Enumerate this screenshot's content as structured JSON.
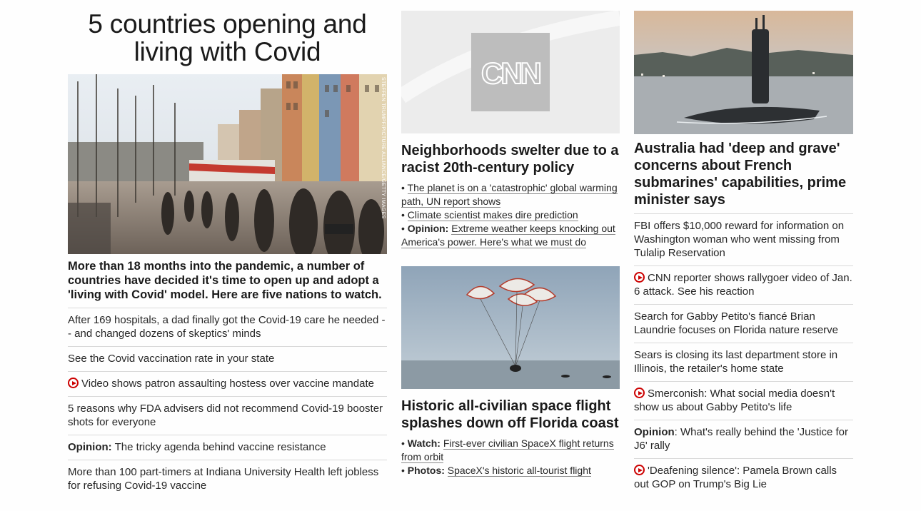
{
  "lead": {
    "title": "5 countries opening and living with Covid",
    "image_credit": "STEFFEN TRUMPF/PICTURE ALLIANCE/GETTY IMAGES",
    "summary": "More than 18 months into the pandemic, a number of countries have decided it's time to open up and adopt a 'living with Covid' model. Here are five nations to watch.",
    "links": [
      {
        "prefix": "",
        "text": "After 169 hospitals, a dad finally got the Covid-19 care he needed -- and changed dozens of skeptics' minds",
        "video": false
      },
      {
        "prefix": "",
        "text": "See the Covid vaccination rate in your state",
        "video": false
      },
      {
        "prefix": "",
        "text": "Video shows patron assaulting hostess over vaccine mandate",
        "video": true
      },
      {
        "prefix": "",
        "text": "5 reasons why FDA advisers did not recommend Covid-19 booster shots for everyone",
        "video": false
      },
      {
        "prefix": "Opinion:",
        "text": "The tricky agenda behind vaccine resistance",
        "video": false
      },
      {
        "prefix": "",
        "text": "More than 100 part-timers at Indiana University Health left jobless for refusing Covid-19 vaccine",
        "video": false
      }
    ]
  },
  "middle": {
    "story1": {
      "logo_text": "CNN",
      "headline": "Neighborhoods swelter due to a racist 20th-century policy",
      "bullets": [
        {
          "prefix": "",
          "text": "The planet is on a 'catastrophic' global warming path, UN report shows"
        },
        {
          "prefix": "",
          "text": "Climate scientist makes dire prediction"
        },
        {
          "prefix": "Opinion:",
          "text": "Extreme weather keeps knocking out America's power. Here's what we must do"
        }
      ]
    },
    "story2": {
      "headline": "Historic all-civilian space flight splashes down off Florida coast",
      "bullets": [
        {
          "prefix": "Watch:",
          "text": "First-ever civilian SpaceX flight returns from orbit"
        },
        {
          "prefix": "Photos:",
          "text": "SpaceX's historic all-tourist flight"
        }
      ]
    }
  },
  "right": {
    "headline": "Australia had 'deep and grave' concerns about French submarines' capabilities, prime minister says",
    "links": [
      {
        "prefix": "",
        "text": "FBI offers $10,000 reward for information on Washington woman who went missing from Tulalip Reservation",
        "video": false
      },
      {
        "prefix": "",
        "text": "CNN reporter shows rallygoer video of Jan. 6 attack. See his reaction",
        "video": true
      },
      {
        "prefix": "",
        "text": "Search for Gabby Petito's fiancé Brian Laundrie focuses on Florida nature reserve",
        "video": false
      },
      {
        "prefix": "",
        "text": "Sears is closing its last department store in Illinois, the retailer's home state",
        "video": false
      },
      {
        "prefix": "",
        "text": "Smerconish: What social media doesn't show us about Gabby Petito's life",
        "video": true
      },
      {
        "prefix": "Opinion",
        "text": ": What's really behind the 'Justice for J6' rally",
        "video": false
      },
      {
        "prefix": "",
        "text": "'Deafening silence': Pamela Brown calls out GOP on Trump's Big Lie",
        "video": true
      }
    ]
  },
  "colors": {
    "video_icon": "#cc0000",
    "divider": "#d9d9d9",
    "text": "#262626"
  }
}
